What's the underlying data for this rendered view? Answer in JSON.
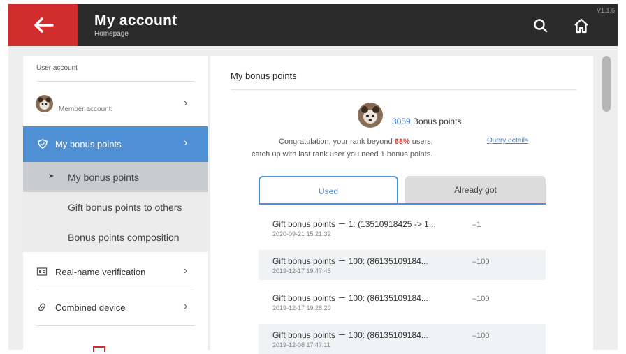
{
  "header": {
    "title": "My account",
    "subtitle": "Homepage",
    "version": "V1.1.6",
    "back_icon": "arrow-left-icon",
    "search_icon": "search-icon",
    "home_icon": "home-icon"
  },
  "sidebar": {
    "heading": "User account",
    "account_label": "Member account:",
    "items": [
      {
        "label": "My bonus points",
        "icon": "shield-icon"
      },
      {
        "label": "Real-name verification",
        "icon": "id-card-icon"
      },
      {
        "label": "Combined device",
        "icon": "link-icon"
      }
    ],
    "sub_items": [
      {
        "label": "My bonus points",
        "marker": "➤"
      },
      {
        "label": "Gift bonus points to others"
      },
      {
        "label": "Bonus points composition"
      }
    ],
    "chevron": "›"
  },
  "main": {
    "title": "My bonus points",
    "points_value": "3059",
    "points_label": "Bonus points",
    "congrats_pre": "Congratulation, your rank beyond ",
    "congrats_pct": "68%",
    "congrats_post": " users,",
    "query_link": "Query details",
    "catchup_text": "catch up with last rank user you need 1 bonus points.",
    "tabs": [
      {
        "label": "Used",
        "active": true
      },
      {
        "label": "Already got",
        "active": false
      }
    ],
    "records": [
      {
        "desc": "Gift bonus points － 1: (13510918425 -> 1...",
        "date": "2020-09-21 15:21:32",
        "amount": "–1"
      },
      {
        "desc": "Gift bonus points － 100: (86135109184...",
        "date": "2019-12-17 19:47:45",
        "amount": "–100"
      },
      {
        "desc": "Gift bonus points － 100: (86135109184...",
        "date": "2019-12-17 19:28:20",
        "amount": "–100"
      },
      {
        "desc": "Gift bonus points － 100: (86135109184...",
        "date": "2019-12-08 17:47:11",
        "amount": "–100"
      }
    ]
  },
  "colors": {
    "header_bg": "#2b2b2b",
    "back_button": "#d22d2d",
    "accent": "#4f8fd4",
    "highlight": "#e3342f"
  }
}
